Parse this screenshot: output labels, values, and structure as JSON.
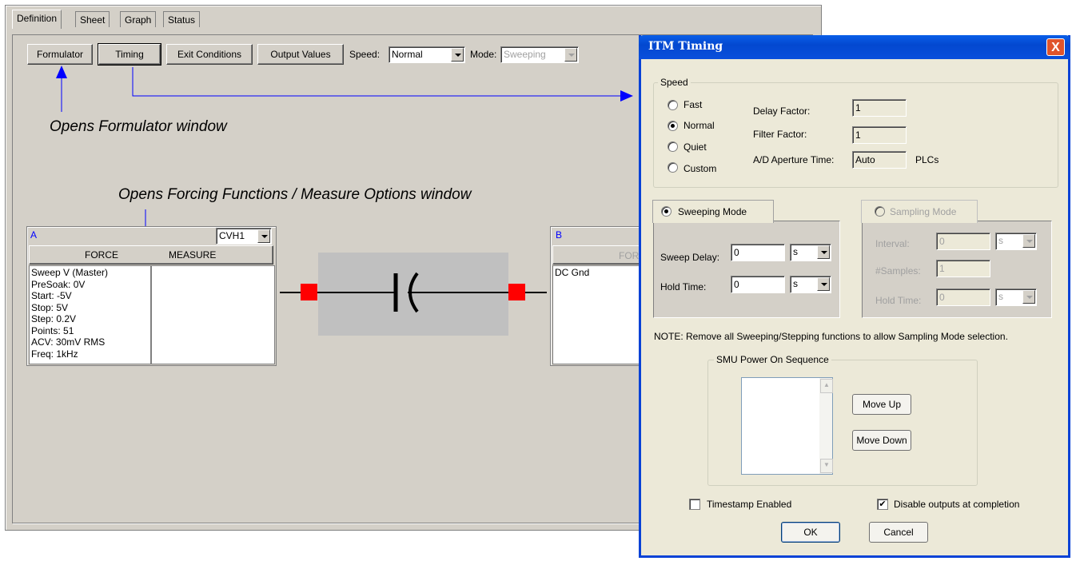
{
  "main": {
    "tabs": [
      "Definition",
      "Sheet",
      "Graph",
      "Status"
    ],
    "toolbar": {
      "formulator": "Formulator",
      "timing": "Timing",
      "exit_conditions": "Exit Conditions",
      "output_values": "Output Values",
      "speed_label": "Speed:",
      "speed_value": "Normal",
      "mode_label": "Mode:",
      "mode_value": "Sweeping"
    },
    "annotations": {
      "formulator_note": "Opens Formulator window",
      "forcing_note": "Opens Forcing Functions / Measure Options window"
    },
    "terminal_a": {
      "name": "A",
      "instrument": "CVH1",
      "force_label": "FORCE",
      "measure_label": "MEASURE",
      "force_lines": [
        "Sweep V (Master)",
        "PreSoak: 0V",
        "Start: -5V",
        "Stop: 5V",
        "Step: 0.2V",
        "Points: 51",
        "ACV: 30mV RMS",
        "Freq: 1kHz"
      ]
    },
    "terminal_b": {
      "name": "B",
      "force_label": "FORCE",
      "force_lines": [
        "DC Gnd"
      ]
    }
  },
  "dialog": {
    "title": "ITM Timing",
    "close": "X",
    "speed_group": "Speed",
    "speed_options": [
      "Fast",
      "Normal",
      "Quiet",
      "Custom"
    ],
    "speed_selected": "Normal",
    "delay_factor_label": "Delay Factor:",
    "delay_factor": "1",
    "filter_factor_label": "Filter Factor:",
    "filter_factor": "1",
    "ad_aperture_label": "A/D Aperture Time:",
    "ad_aperture": "Auto",
    "ad_unit": "PLCs",
    "sweeping_mode": "Sweeping Mode",
    "sweep_delay_label": "Sweep Delay:",
    "sweep_delay": "0",
    "sweep_delay_unit": "s",
    "hold_time_label": "Hold Time:",
    "hold_time": "0",
    "hold_time_unit": "s",
    "sampling_mode": "Sampling Mode",
    "interval_label": "Interval:",
    "interval": "0",
    "interval_unit": "s",
    "samples_label": "#Samples:",
    "samples": "1",
    "sampling_hold_label": "Hold Time:",
    "sampling_hold": "0",
    "sampling_hold_unit": "s",
    "note": "NOTE: Remove all Sweeping/Stepping functions to allow Sampling Mode selection.",
    "smu_group": "SMU Power On Sequence",
    "move_up": "Move Up",
    "move_down": "Move Down",
    "timestamp": "Timestamp Enabled",
    "timestamp_checked": false,
    "disable_outputs": "Disable outputs at completion",
    "disable_outputs_checked": true,
    "ok": "OK",
    "cancel": "Cancel"
  },
  "colors": {
    "title_blue": "#0a4fdc",
    "arrow_blue": "#0000ff",
    "terminal_red": "#ff0000",
    "device_gray": "#c0c0c0"
  }
}
